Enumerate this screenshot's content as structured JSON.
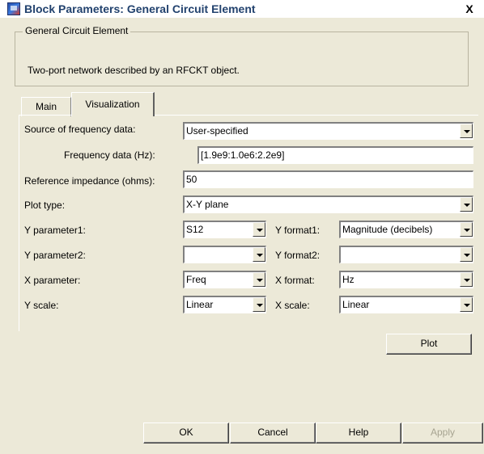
{
  "window": {
    "title": "Block Parameters: General Circuit Element",
    "close_label": "X"
  },
  "group": {
    "legend": "General Circuit Element",
    "description": "Two-port network described by an RFCKT object."
  },
  "tabs": [
    {
      "label": "Main",
      "active": false
    },
    {
      "label": "Visualization",
      "active": true
    }
  ],
  "form": {
    "source_label": "Source of frequency data:",
    "source_value": "User-specified",
    "freq_label": "Frequency data (Hz):",
    "freq_value": "[1.9e9:1.0e6:2.2e9]",
    "ref_label": "Reference impedance (ohms):",
    "ref_value": "50",
    "plot_type_label": "Plot type:",
    "plot_type_value": "X-Y plane",
    "y_param1_label": "Y parameter1:",
    "y_param1_value": "S12",
    "y_format1_label": "Y format1:",
    "y_format1_value": "Magnitude (decibels)",
    "y_param2_label": "Y parameter2:",
    "y_param2_value": "",
    "y_format2_label": "Y format2:",
    "y_format2_value": "",
    "x_param_label": "X parameter:",
    "x_param_value": "Freq",
    "x_format_label": "X format:",
    "x_format_value": "Hz",
    "y_scale_label": "Y scale:",
    "y_scale_value": "Linear",
    "x_scale_label": "X scale:",
    "x_scale_value": "Linear",
    "plot_button": "Plot"
  },
  "buttons": {
    "ok": "OK",
    "cancel": "Cancel",
    "help": "Help",
    "apply": "Apply"
  }
}
